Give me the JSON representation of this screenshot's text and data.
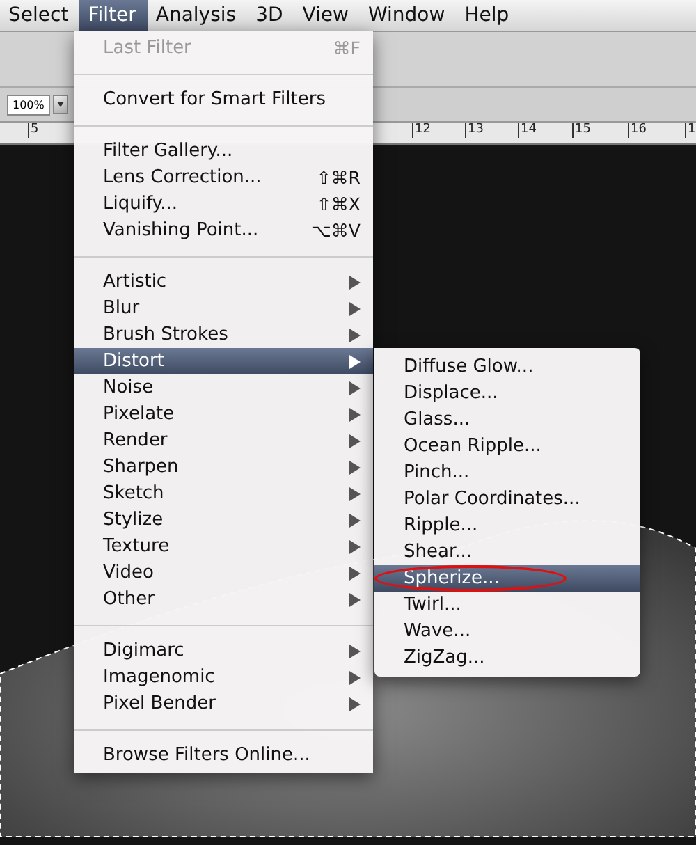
{
  "menubar": [
    {
      "label": "Select",
      "selected": false
    },
    {
      "label": "Filter",
      "selected": true
    },
    {
      "label": "Analysis",
      "selected": false
    },
    {
      "label": "3D",
      "selected": false
    },
    {
      "label": "View",
      "selected": false
    },
    {
      "label": "Window",
      "selected": false
    },
    {
      "label": "Help",
      "selected": false
    }
  ],
  "options_bar": {
    "zoom": "100%"
  },
  "ruler": {
    "labels": [
      "5",
      "12",
      "13",
      "14",
      "15",
      "16",
      "1"
    ]
  },
  "filter_menu": {
    "groups": [
      [
        {
          "label": "Last Filter",
          "shortcut": "⌘F",
          "submenu": false,
          "disabled": true,
          "selected": false
        }
      ],
      [
        {
          "label": "Convert for Smart Filters",
          "submenu": false,
          "disabled": false,
          "selected": false
        }
      ],
      [
        {
          "label": "Filter Gallery...",
          "submenu": false,
          "disabled": false,
          "selected": false
        },
        {
          "label": "Lens Correction...",
          "shortcut": "⇧⌘R",
          "submenu": false,
          "disabled": false,
          "selected": false
        },
        {
          "label": "Liquify...",
          "shortcut": "⇧⌘X",
          "submenu": false,
          "disabled": false,
          "selected": false
        },
        {
          "label": "Vanishing Point...",
          "shortcut": "⌥⌘V",
          "submenu": false,
          "disabled": false,
          "selected": false
        }
      ],
      [
        {
          "label": "Artistic",
          "submenu": true,
          "disabled": false,
          "selected": false
        },
        {
          "label": "Blur",
          "submenu": true,
          "disabled": false,
          "selected": false
        },
        {
          "label": "Brush Strokes",
          "submenu": true,
          "disabled": false,
          "selected": false
        },
        {
          "label": "Distort",
          "submenu": true,
          "disabled": false,
          "selected": true
        },
        {
          "label": "Noise",
          "submenu": true,
          "disabled": false,
          "selected": false
        },
        {
          "label": "Pixelate",
          "submenu": true,
          "disabled": false,
          "selected": false
        },
        {
          "label": "Render",
          "submenu": true,
          "disabled": false,
          "selected": false
        },
        {
          "label": "Sharpen",
          "submenu": true,
          "disabled": false,
          "selected": false
        },
        {
          "label": "Sketch",
          "submenu": true,
          "disabled": false,
          "selected": false
        },
        {
          "label": "Stylize",
          "submenu": true,
          "disabled": false,
          "selected": false
        },
        {
          "label": "Texture",
          "submenu": true,
          "disabled": false,
          "selected": false
        },
        {
          "label": "Video",
          "submenu": true,
          "disabled": false,
          "selected": false
        },
        {
          "label": "Other",
          "submenu": true,
          "disabled": false,
          "selected": false
        }
      ],
      [
        {
          "label": "Digimarc",
          "submenu": true,
          "disabled": false,
          "selected": false
        },
        {
          "label": "Imagenomic",
          "submenu": true,
          "disabled": false,
          "selected": false
        },
        {
          "label": "Pixel Bender",
          "submenu": true,
          "disabled": false,
          "selected": false
        }
      ],
      [
        {
          "label": "Browse Filters Online...",
          "submenu": false,
          "disabled": false,
          "selected": false
        }
      ]
    ]
  },
  "distort_submenu": {
    "items": [
      {
        "label": "Diffuse Glow...",
        "selected": false,
        "circled": false
      },
      {
        "label": "Displace...",
        "selected": false,
        "circled": false
      },
      {
        "label": "Glass...",
        "selected": false,
        "circled": false
      },
      {
        "label": "Ocean Ripple...",
        "selected": false,
        "circled": false
      },
      {
        "label": "Pinch...",
        "selected": false,
        "circled": false
      },
      {
        "label": "Polar Coordinates...",
        "selected": false,
        "circled": false
      },
      {
        "label": "Ripple...",
        "selected": false,
        "circled": false
      },
      {
        "label": "Shear...",
        "selected": false,
        "circled": false
      },
      {
        "label": "Spherize...",
        "selected": true,
        "circled": true
      },
      {
        "label": "Twirl...",
        "selected": false,
        "circled": false
      },
      {
        "label": "Wave...",
        "selected": false,
        "circled": false
      },
      {
        "label": "ZigZag...",
        "selected": false,
        "circled": false
      }
    ]
  }
}
